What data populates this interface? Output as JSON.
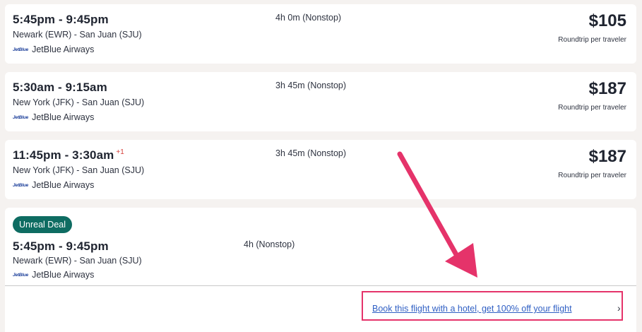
{
  "flights": [
    {
      "time": "5:45pm - 9:45pm",
      "day_offset": "",
      "route": "Newark (EWR) - San Juan (SJU)",
      "airline_logo": "JetBlue",
      "airline": "JetBlue Airways",
      "duration": "4h 0m (Nonstop)",
      "price": "$105",
      "price_note": "Roundtrip per traveler"
    },
    {
      "time": "5:30am - 9:15am",
      "day_offset": "",
      "route": "New York (JFK) - San Juan (SJU)",
      "airline_logo": "JetBlue",
      "airline": "JetBlue Airways",
      "duration": "3h 45m (Nonstop)",
      "price": "$187",
      "price_note": "Roundtrip per traveler"
    },
    {
      "time": "11:45pm - 3:30am",
      "day_offset": "+1",
      "route": "New York (JFK) - San Juan (SJU)",
      "airline_logo": "JetBlue",
      "airline": "JetBlue Airways",
      "duration": "3h 45m (Nonstop)",
      "price": "$187",
      "price_note": "Roundtrip per traveler"
    }
  ],
  "deal": {
    "badge": "Unreal Deal",
    "time": "5:45pm - 9:45pm",
    "route": "Newark (EWR) - San Juan (SJU)",
    "airline_logo": "JetBlue",
    "airline": "JetBlue Airways",
    "duration": "4h (Nonstop)",
    "promo_link": "Book this flight with a hotel, get 100% off your flight",
    "chevron": "›"
  },
  "colors": {
    "badge_bg": "#0e6c62",
    "link": "#2f5fc4",
    "annotation": "#e5336a",
    "day_offset": "#d6403b"
  },
  "icons": [
    "jetblue-logo-icon",
    "chevron-right-icon",
    "annotation-arrow"
  ]
}
